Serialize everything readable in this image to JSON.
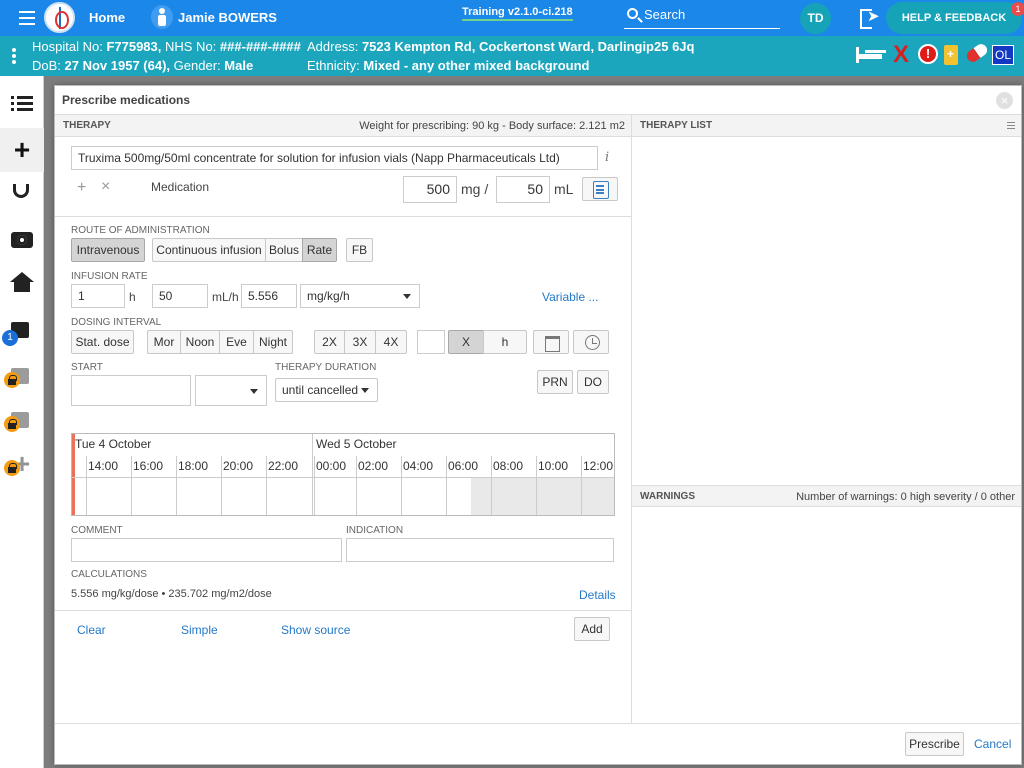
{
  "topbar": {
    "home_label": "Home",
    "patient_name": "Jamie BOWERS",
    "training": "Training v2.1.0-ci.218",
    "search_label": "Search",
    "avatar_initials": "TD",
    "help_label": "HELP & FEEDBACK",
    "help_badge": "1"
  },
  "banner": {
    "hospital_label": "Hospital No:",
    "hospital_no": "F775983,",
    "nhs_label": "NHS No:",
    "nhs_no": "###-###-####",
    "address_label": "Address:",
    "address": "7523 Kempton Rd, Cockertonst Ward, Darlingip25 6Jq",
    "dob_label": "DoB:",
    "dob": "27 Nov 1957 (64),",
    "gender_label": "Gender:",
    "gender": "Male",
    "ethnicity_label": "Ethnicity:",
    "ethnicity": "Mixed - any other mixed background",
    "x_symbol": "X",
    "alert_symbol": "!",
    "ol_label": "OL"
  },
  "nav": {
    "badge_count": "1"
  },
  "modal": {
    "title": "Prescribe medications",
    "close_symbol": "×"
  },
  "therapy": {
    "header": "THERAPY",
    "weight_info": "Weight for prescribing: 90 kg - Body surface: 2.121 m2",
    "medication_value": "Truxima 500mg/50ml concentrate for solution for infusion vials (Napp Pharmaceuticals Ltd)",
    "info_symbol": "i",
    "plus_symbol": "+",
    "x_symbol": "×",
    "medication_label": "Medication",
    "dose_value": "500",
    "dose_unit": "mg /",
    "volume_value": "50",
    "volume_unit": "mL",
    "route_label": "ROUTE OF ADMINISTRATION",
    "route_intravenous": "Intravenous",
    "route_continuous": "Continuous infusion",
    "route_bolus": "Bolus",
    "route_rate": "Rate",
    "route_fb": "FB",
    "infusion_rate_label": "INFUSION RATE",
    "rate_duration_value": "1",
    "rate_duration_unit": "h",
    "rate_volume_value": "50",
    "rate_volume_unit": "mL/h",
    "rate_dose_value": "5.556",
    "rate_dose_unit": "mg/kg/h",
    "variable_link": "Variable ...",
    "dosing_interval_label": "DOSING INTERVAL",
    "stat_dose": "Stat. dose",
    "mor": "Mor",
    "noon": "Noon",
    "eve": "Eve",
    "night": "Night",
    "x2": "2X",
    "x3": "3X",
    "x4": "4X",
    "freq_value": "",
    "freq_x": "X",
    "freq_h": "h",
    "start_label": "START",
    "start_value": "",
    "start_time": "",
    "duration_label": "THERAPY DURATION",
    "duration_value": "until cancelled",
    "prn": "PRN",
    "do": "DO",
    "timeline": {
      "day1": "Tue 4 October",
      "day2": "Wed 5 October",
      "hours": [
        "14:00",
        "16:00",
        "18:00",
        "20:00",
        "22:00",
        "00:00",
        "02:00",
        "04:00",
        "06:00",
        "08:00",
        "10:00",
        "12:00"
      ]
    },
    "comment_label": "COMMENT",
    "comment_value": "",
    "indication_label": "INDICATION",
    "indication_value": "",
    "calculations_label": "CALCULATIONS",
    "calculations_value": "5.556 mg/kg/dose • 235.702 mg/m2/dose",
    "details_link": "Details",
    "clear_link": "Clear",
    "simple_link": "Simple",
    "show_source_link": "Show source",
    "add_button": "Add"
  },
  "therapy_list": {
    "header": "THERAPY LIST"
  },
  "warnings": {
    "header": "WARNINGS",
    "summary": "Number of warnings: 0 high severity / 0 other"
  },
  "footer": {
    "prescribe": "Prescribe",
    "cancel": "Cancel"
  }
}
